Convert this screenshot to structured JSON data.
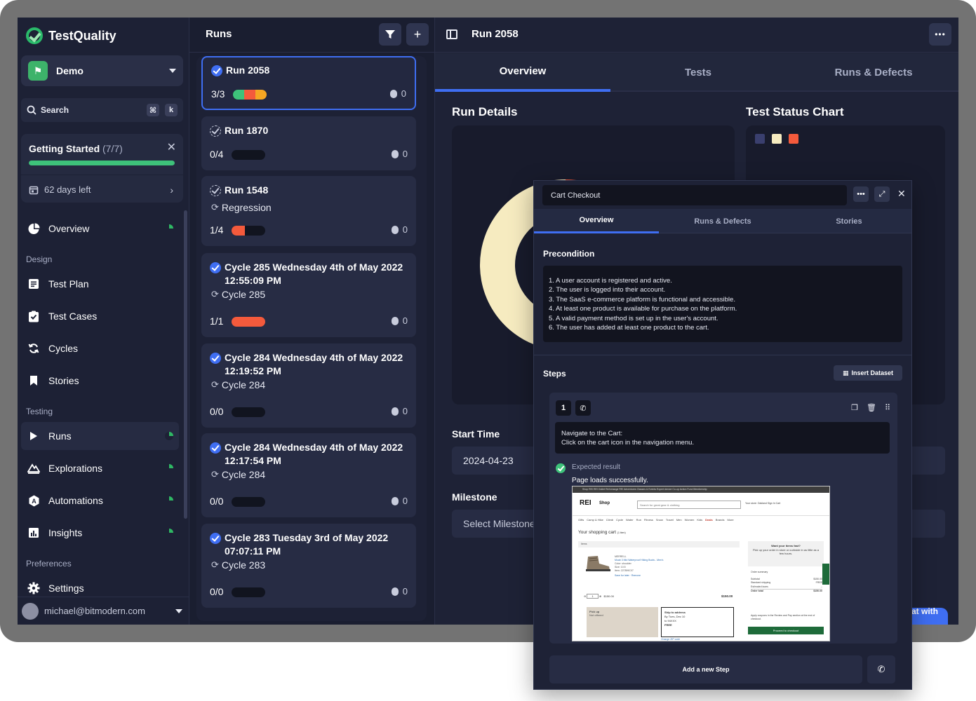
{
  "app": {
    "name": "TestQuality",
    "project": "Demo",
    "search": {
      "label": "Search",
      "key1": "⌘",
      "key2": "k"
    },
    "getting_started": {
      "title": "Getting Started",
      "count": "(7/7)",
      "progress": 1.0,
      "days_left": "62 days left"
    },
    "sections": {
      "design": "Design",
      "testing": "Testing",
      "preferences": "Preferences"
    },
    "nav": {
      "overview": "Overview",
      "test_plan": "Test Plan",
      "test_cases": "Test Cases",
      "cycles": "Cycles",
      "stories": "Stories",
      "runs": "Runs",
      "explorations": "Explorations",
      "automations": "Automations",
      "insights": "Insights",
      "settings": "Settings"
    },
    "user": "michael@bitmodern.com"
  },
  "runs": {
    "title": "Runs",
    "items": [
      {
        "title": "Run 2058",
        "subtitle": "",
        "count": "3/3",
        "bugs": "0",
        "bar": [
          {
            "c": "#3ec27a",
            "w": 0.33
          },
          {
            "c": "#f45a3c",
            "w": 0.34
          },
          {
            "c": "#f5a623",
            "w": 0.33
          }
        ]
      },
      {
        "title": "Run 1870",
        "subtitle": "",
        "count": "0/4",
        "bugs": "0",
        "bar": []
      },
      {
        "title": "Run 1548",
        "subtitle": "Regression",
        "count": "1/4",
        "bugs": "0",
        "bar": [
          {
            "c": "#f45a3c",
            "w": 0.4
          }
        ]
      },
      {
        "title": "Cycle 285 Wednesday 4th of May 2022 12:55:09 PM",
        "subtitle": "Cycle 285",
        "count": "1/1",
        "bugs": "0",
        "bar": [
          {
            "c": "#f45a3c",
            "w": 1.0
          }
        ]
      },
      {
        "title": "Cycle 284 Wednesday 4th of May 2022 12:19:52 PM",
        "subtitle": "Cycle 284",
        "count": "0/0",
        "bugs": "0",
        "bar": []
      },
      {
        "title": "Cycle 284 Wednesday 4th of May 2022 12:17:54 PM",
        "subtitle": "Cycle 284",
        "count": "0/0",
        "bugs": "0",
        "bar": []
      },
      {
        "title": "Cycle 283 Tuesday 3rd of May 2022 07:07:11 PM",
        "subtitle": "Cycle 283",
        "count": "0/0",
        "bugs": "0",
        "bar": []
      }
    ]
  },
  "detail": {
    "title": "Run 2058",
    "tabs": [
      "Overview",
      "Tests",
      "Runs & Defects"
    ],
    "run_details": "Run Details",
    "chart_title": "Test Status Chart",
    "legend_colors": [
      "#3a3f6e",
      "#f6ebc0",
      "#f45a3c"
    ],
    "start_time_label": "Start Time",
    "start_time": "2024-04-23",
    "milestone_label": "Milestone",
    "milestone_placeholder": "Select Milestone",
    "chat_label": "Chat with us"
  },
  "chart_data": {
    "type": "pie",
    "title": "",
    "slices": [
      {
        "value": 67,
        "color": "#f6ebc0"
      },
      {
        "value": 33,
        "color": "#f45a3c"
      }
    ]
  },
  "popup": {
    "title": "Cart Checkout",
    "tabs": [
      "Overview",
      "Runs & Defects",
      "Stories"
    ],
    "precondition_label": "Precondition",
    "preconditions": [
      "1.  A user account is registered and active.",
      "2.  The user is logged into their account.",
      "3.  The SaaS e-commerce platform is functional and accessible.",
      "4.  At least one product is available for purchase on the platform.",
      "5.  A valid payment method is set up in the user's account.",
      "6.  The user has added at least one product to the cart."
    ],
    "steps_label": "Steps",
    "insert_dataset": "Insert Dataset",
    "step": {
      "number": "1",
      "text_line1": "Navigate to the Cart:",
      "text_line2": "Click on the cart icon in the navigation menu.",
      "expected_label": "Expected result",
      "expected_text": "Page loads successfully."
    },
    "add_step": "Add a new Step"
  },
  "mini_shop": {
    "topbar": "Shop REI   REI Outlet   ReXchange   REI Adventures   Classes & Events   Expert Advice   Co-op Action Fund   Membership",
    "logo": "REI",
    "shop": "Shop",
    "search_placeholder": "Search for great gear & clothing",
    "right": "Your store: Oakland   Sign In   Cart",
    "categories": [
      "Gifts",
      "Camp & Hike",
      "Climb",
      "Cycle",
      "Water",
      "Run",
      "Fitness",
      "Snow",
      "Travel",
      "Men",
      "Women",
      "Kids",
      "Deals",
      "Brands",
      "More"
    ],
    "cart_title": "Your shopping cart",
    "cart_count": "(1 item)",
    "items_label": "Items",
    "brand": "MERRELL",
    "product": "Moab 3 Mid Waterproof Hiking Boots - Men's",
    "product_meta1": "Color: shoulder",
    "product_meta2": "Size: 10.5",
    "product_meta3": "Item: 227899C07",
    "product_actions": "Save for later · Remove",
    "qty": "1",
    "unit_price": "$150.00",
    "line_total": "$150.00",
    "pickup_title": "Pick up",
    "pickup_sub": "Not offered",
    "ship_title": "Ship to address",
    "ship_line1": "By Tues, Dec 10",
    "ship_line2": "to 94XXX",
    "ship_line3": "FREE",
    "change_zip": "Change ZIP code",
    "side_title": "Want your items fast?",
    "side_text": "Pick up your order in store or curbside in as little as a few hours.",
    "summary_title": "Order summary",
    "subtotal_label": "Subtotal",
    "subtotal": "$150.00",
    "shipping_label": "Standard shipping",
    "shipping": "FREE",
    "taxes_label": "Estimated taxes",
    "taxes": "--",
    "total_label": "Order total",
    "total": "$150.00",
    "coupon": "Apply coupons in the Review and Pay section at the end of checkout.",
    "checkout": "Proceed to checkout"
  }
}
